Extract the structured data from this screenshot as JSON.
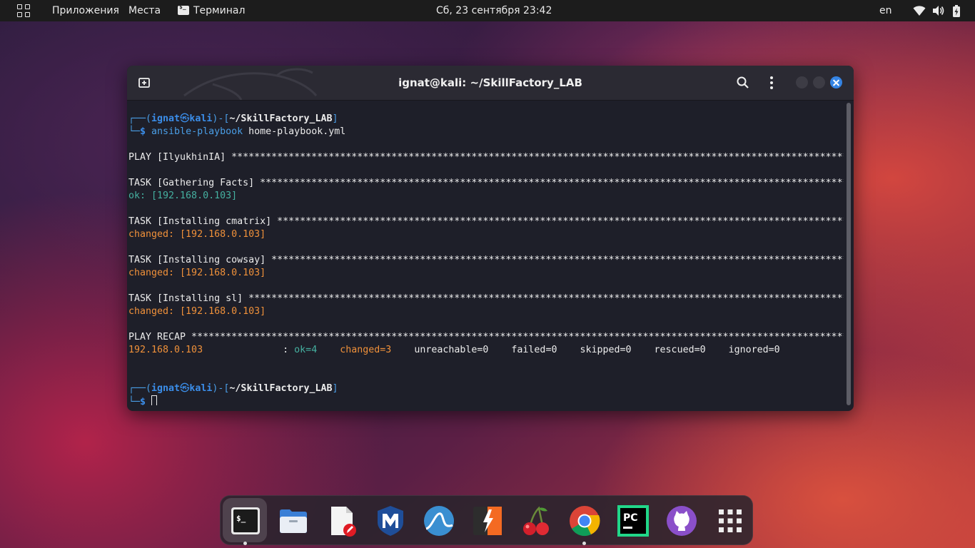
{
  "topbar": {
    "apps_label": "Приложения",
    "places_label": "Места",
    "terminal_label": "Терминал",
    "clock": "Сб, 23 сентября  23:42",
    "lang": "en"
  },
  "window": {
    "title": "ignat@kali: ~/SkillFactory_LAB"
  },
  "terminal": {
    "prompt1": {
      "user": "ignat",
      "at": "㉿",
      "host": "kali",
      "dir": "~/SkillFactory_LAB",
      "cmd": "ansible-playbook",
      "arg": "home-playbook.yml"
    },
    "play_line": "PLAY [IlyukhinIA] ***************************************************************************************************************",
    "task1": "TASK [Gathering Facts] **********************************************************************************************************",
    "task1_result": "ok: [192.168.0.103]",
    "task2": "TASK [Installing cmatrix] *******************************************************************************************************",
    "task2_result": "changed: [192.168.0.103]",
    "task3": "TASK [Installing cowsay] ********************************************************************************************************",
    "task3_result": "changed: [192.168.0.103]",
    "task4": "TASK [Installing sl] ************************************************************************************************************",
    "task4_result": "changed: [192.168.0.103]",
    "recap": "PLAY RECAP **********************************************************************************************************************",
    "recap_host": "192.168.0.103",
    "recap_sep": "              : ",
    "recap_ok": "ok=4",
    "recap_changed": "changed=3",
    "recap_rest": "    unreachable=0    failed=0    skipped=0    rescued=0    ignored=0",
    "prompt2": {
      "user": "ignat",
      "at": "㉿",
      "host": "kali",
      "dir": "~/SkillFactory_LAB"
    }
  },
  "dock": {
    "items": [
      "terminal-icon",
      "files-icon",
      "text-editor-icon",
      "metasploit-icon",
      "wireshark-icon",
      "burpsuite-icon",
      "cherrytree-icon",
      "chrome-icon",
      "pycharm-icon",
      "github-desktop-icon",
      "app-grid-icon"
    ]
  },
  "colors": {
    "prompt_blue": "#3b8eea",
    "ok_green": "#45b0a0",
    "changed_orange": "#f0913a",
    "close_button": "#3584e4"
  }
}
